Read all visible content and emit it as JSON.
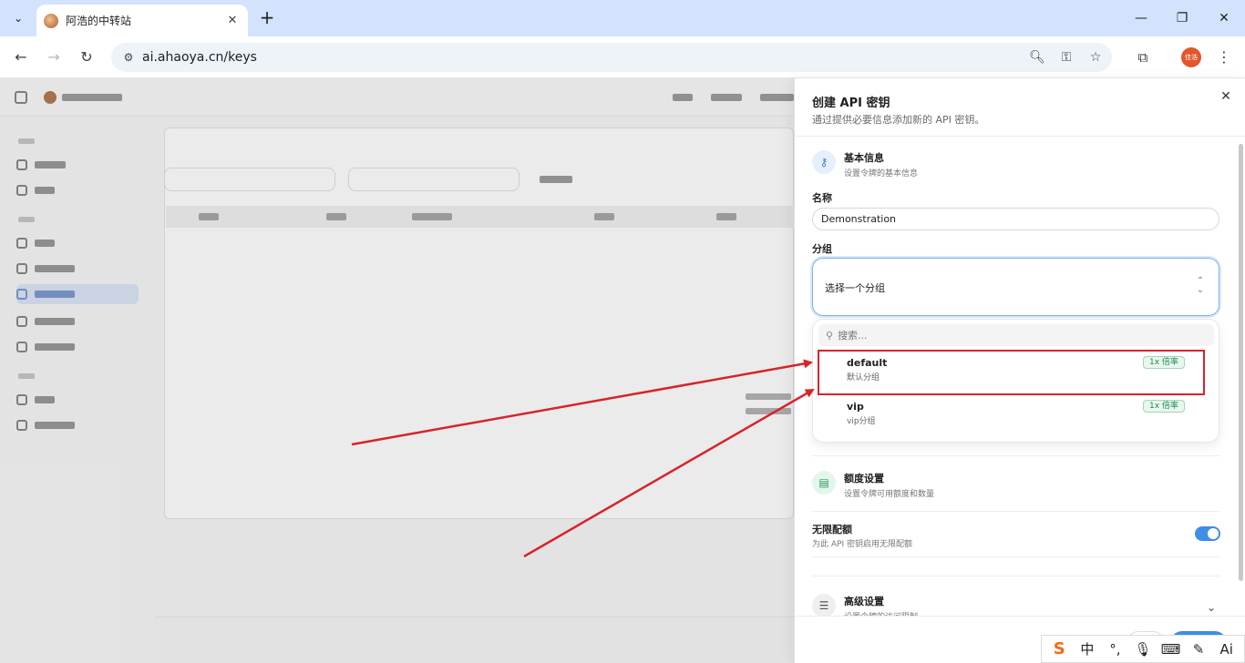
{
  "browser": {
    "tab_title": "阿浩的中转站",
    "url": "ai.ahaoya.cn/keys",
    "profile_label": "佳浩"
  },
  "drawer": {
    "title": "创建 API 密钥",
    "description": "通过提供必要信息添加新的 API 密钥。",
    "basic_section": {
      "title": "基本信息",
      "description": "设置令牌的基本信息"
    },
    "name_label": "名称",
    "name_value": "Demonstration",
    "group_label": "分组",
    "group_select_placeholder": "选择一个分组",
    "dropdown": {
      "search_placeholder": "搜索...",
      "items": [
        {
          "name": "default",
          "description": "默认分组",
          "badge": "1x 倍率"
        },
        {
          "name": "vip",
          "description": "vip分组",
          "badge": "1x 倍率"
        }
      ]
    },
    "quota_section": {
      "title": "额度设置",
      "description": "设置令牌可用额度和数量"
    },
    "unlimited": {
      "label": "无限配额",
      "description": "为此 API 密钥启用无限配额",
      "enabled": true
    },
    "advanced_section": {
      "title": "高级设置",
      "description": "设置令牌的访问限制"
    }
  },
  "ime": {
    "lang": "中",
    "punct": "°,",
    "ai": "Ai"
  },
  "colors": {
    "accent": "#3e8ee6",
    "annotation_red": "#d8232a",
    "badge_green": "#1d8a4e"
  }
}
